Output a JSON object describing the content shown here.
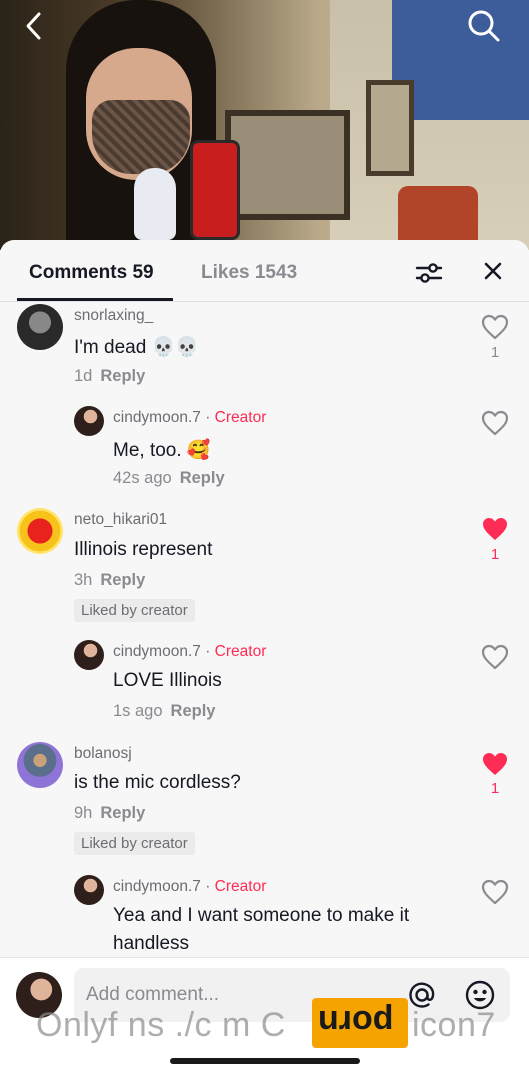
{
  "header": {
    "back_icon": "chevron-left-icon",
    "search_icon": "search-icon"
  },
  "tabs": {
    "comments_label": "Comments 59",
    "likes_label": "Likes 1543"
  },
  "comments": [
    {
      "username": "snorlaxing_",
      "text": "I'm dead 💀💀",
      "time": "1d",
      "reply": "Reply",
      "likes": "1",
      "liked": false
    },
    {
      "username": "cindymoon.7",
      "creator_sep": " · ",
      "creator": "Creator",
      "text": "Me, too. 🥰",
      "time": "42s ago",
      "reply": "Reply",
      "liked": false
    },
    {
      "username": "neto_hikari01",
      "text": "Illinois represent",
      "time": "3h",
      "reply": "Reply",
      "badge": "Liked by creator",
      "likes": "1",
      "liked": true
    },
    {
      "username": "cindymoon.7",
      "creator_sep": " · ",
      "creator": "Creator",
      "text": "LOVE Illinois",
      "time": "1s ago",
      "reply": "Reply",
      "liked": false
    },
    {
      "username": "bolanosj",
      "text": "is the mic cordless?",
      "time": "9h",
      "reply": "Reply",
      "badge": "Liked by creator",
      "likes": "1",
      "liked": true
    },
    {
      "username": "cindymoon.7",
      "creator_sep": " · ",
      "creator": "Creator",
      "text_line1": "Yea and I want someone to make it",
      "text_line2": "handless",
      "liked": false
    }
  ],
  "input": {
    "placeholder": "Add comment...",
    "at_icon": "at-icon",
    "emoji_icon": "emoji-icon"
  },
  "watermark": {
    "text": "Onlyf ns ./c m C",
    "logo": "porn",
    "suffix": "icon7"
  },
  "colors": {
    "accent": "#fe2c55",
    "text": "#161823",
    "muted": "#8a8b91"
  }
}
